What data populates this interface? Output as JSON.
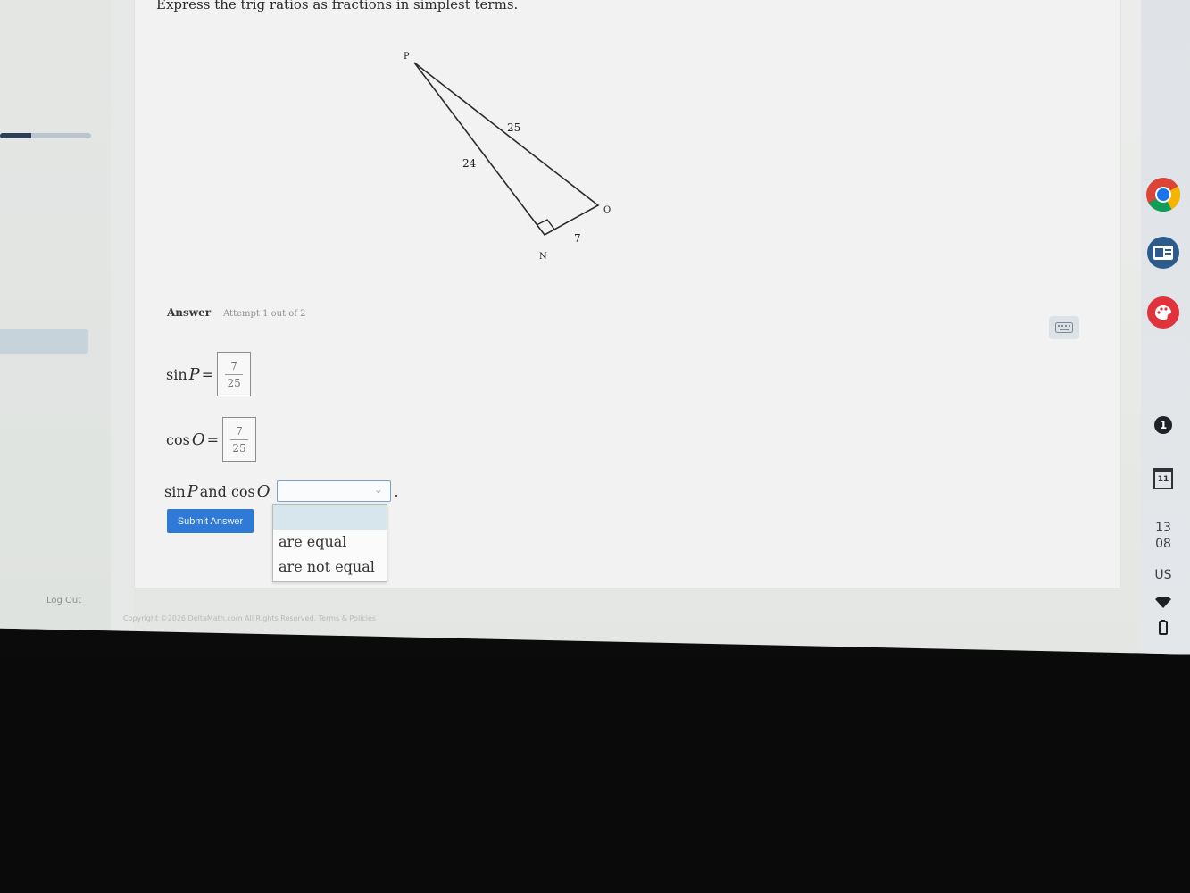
{
  "question": {
    "text": "Express the trig ratios as fractions in simplest terms."
  },
  "diagram": {
    "vertex_p": "P",
    "vertex_o": "O",
    "vertex_n": "N",
    "side_po": "25",
    "side_pn": "24",
    "side_no": "7"
  },
  "answer": {
    "label": "Answer",
    "attempt": "Attempt 1 out of 2",
    "sin_row": {
      "prefix": "sin",
      "var": "P",
      "eq": "=",
      "numerator": "7",
      "denominator": "25"
    },
    "cos_row": {
      "prefix": "cos",
      "var": "O",
      "eq": "=",
      "numerator": "7",
      "denominator": "25"
    },
    "compare_row": {
      "part1": "sin",
      "var1": "P",
      "mid": "and cos",
      "var2": "O",
      "period": "."
    },
    "dropdown": {
      "selected": "",
      "options": [
        "are equal",
        "are not equal"
      ]
    },
    "submit_label": "Submit Answer"
  },
  "sidebar": {
    "logout_label": "Log Out",
    "progress_fraction": 0.34
  },
  "footer": {
    "copyright": "Copyright ©2026 DeltaMath.com All Rights Reserved. Terms & Policies"
  },
  "shelf": {
    "notification_count": "1",
    "calendar_day": "11",
    "time_hour": "13",
    "time_minute": "08",
    "locale": "US"
  },
  "icons": {
    "chrome": "chrome-icon",
    "classroom": "classroom-icon",
    "palette": "palette-icon",
    "keyboard": "keyboard-icon",
    "wifi": "wifi-icon",
    "battery": "battery-icon"
  },
  "colors": {
    "submit_button": "#2f7ad8",
    "dropdown_highlight": "#d7e6ec",
    "select_border": "#7aa0c8"
  }
}
